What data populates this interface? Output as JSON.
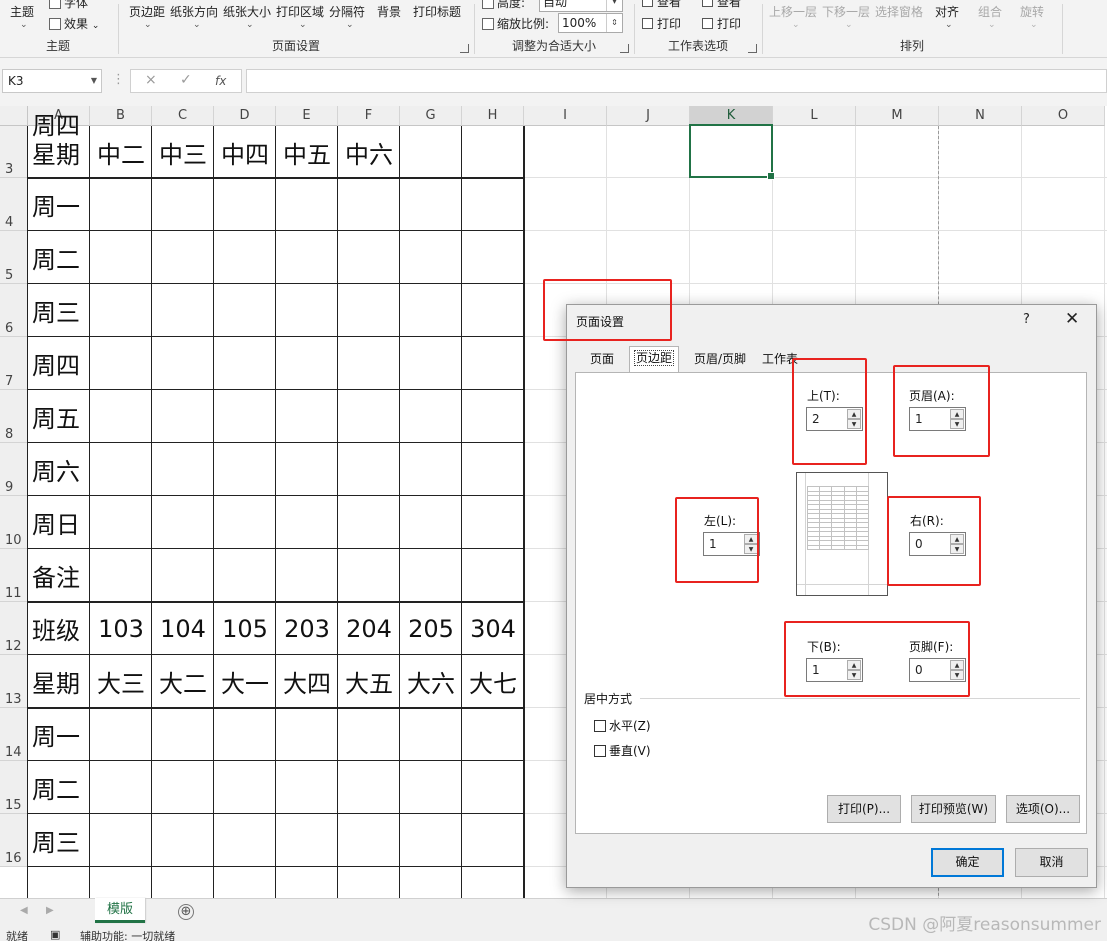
{
  "ribbon": {
    "themes": {
      "theme": "主题",
      "fonts": "字体",
      "effects": "效果",
      "group": "主题"
    },
    "page_setup": {
      "margins": "页边距",
      "orientation": "纸张方向",
      "size": "纸张大小",
      "print_area": "打印区域",
      "breaks": "分隔符",
      "background": "背景",
      "print_titles": "打印标题",
      "group": "页面设置"
    },
    "scale_to_fit": {
      "height_label": "高度:",
      "height_value": "自动",
      "scale_label": "缩放比例:",
      "scale_value": "100%",
      "group": "调整为合适大小"
    },
    "sheet_options": {
      "gridlines_view": "查看",
      "gridlines_print": "打印",
      "headings_view": "查看",
      "headings_print": "打印",
      "group": "工作表选项"
    },
    "arrange": {
      "bring_forward": "上移一层",
      "send_backward": "下移一层",
      "selection_pane": "选择窗格",
      "align": "对齐",
      "group_btn": "组合",
      "rotate": "旋转",
      "group": "排列"
    }
  },
  "formula_bar": {
    "name_box": "K3",
    "cancel_icon": "×",
    "enter_icon": "✓",
    "fx": "fx",
    "value": ""
  },
  "columns": [
    "A",
    "B",
    "C",
    "D",
    "E",
    "F",
    "G",
    "H",
    "I",
    "J",
    "K",
    "L",
    "M",
    "N",
    "O"
  ],
  "selected_column": "K",
  "rows": [
    "3",
    "4",
    "5",
    "6",
    "7",
    "8",
    "9",
    "10",
    "11",
    "12",
    "13",
    "14",
    "15",
    "16"
  ],
  "sheet": {
    "r3": [
      "星期",
      "中二",
      "中三",
      "中四",
      "中五",
      "中六",
      "",
      ""
    ],
    "labels_a": [
      "周一",
      "周二",
      "周三",
      "周四",
      "周五",
      "周六",
      "周日",
      "备注"
    ],
    "r12": [
      "班级",
      "103",
      "104",
      "105",
      "203",
      "204",
      "205",
      "304"
    ],
    "r13": [
      "星期",
      "大三",
      "大二",
      "大一",
      "大四",
      "大五",
      "大六",
      "大七"
    ],
    "labels_b": [
      "周一",
      "周二",
      "周三",
      "周四"
    ]
  },
  "dialog": {
    "title": "页面设置",
    "help": "?",
    "close": "✕",
    "tabs": [
      "页面",
      "页边距",
      "页眉/页脚",
      "工作表"
    ],
    "active_tab": "页边距",
    "top_label": "上(T):",
    "top_value": "2",
    "header_label": "页眉(A):",
    "header_value": "1",
    "left_label": "左(L):",
    "left_value": "1",
    "right_label": "右(R):",
    "right_value": "0",
    "bottom_label": "下(B):",
    "bottom_value": "1",
    "footer_label": "页脚(F):",
    "footer_value": "0",
    "center_section": "居中方式",
    "horizontal": "水平(Z)",
    "vertical": "垂直(V)",
    "print_btn": "打印(P)...",
    "preview_btn": "打印预览(W)",
    "options_btn": "选项(O)...",
    "ok": "确定",
    "cancel": "取消"
  },
  "sheet_tab": "模版",
  "add_sheet": "⊕",
  "status": {
    "ready": "就绪",
    "accessibility": "辅助功能: 一切就绪"
  },
  "watermark": "CSDN @阿夏reasonsummer",
  "colors": {
    "excel_green": "#217346",
    "annotation_red": "#e8231f",
    "primary_blue": "#0078d7"
  }
}
